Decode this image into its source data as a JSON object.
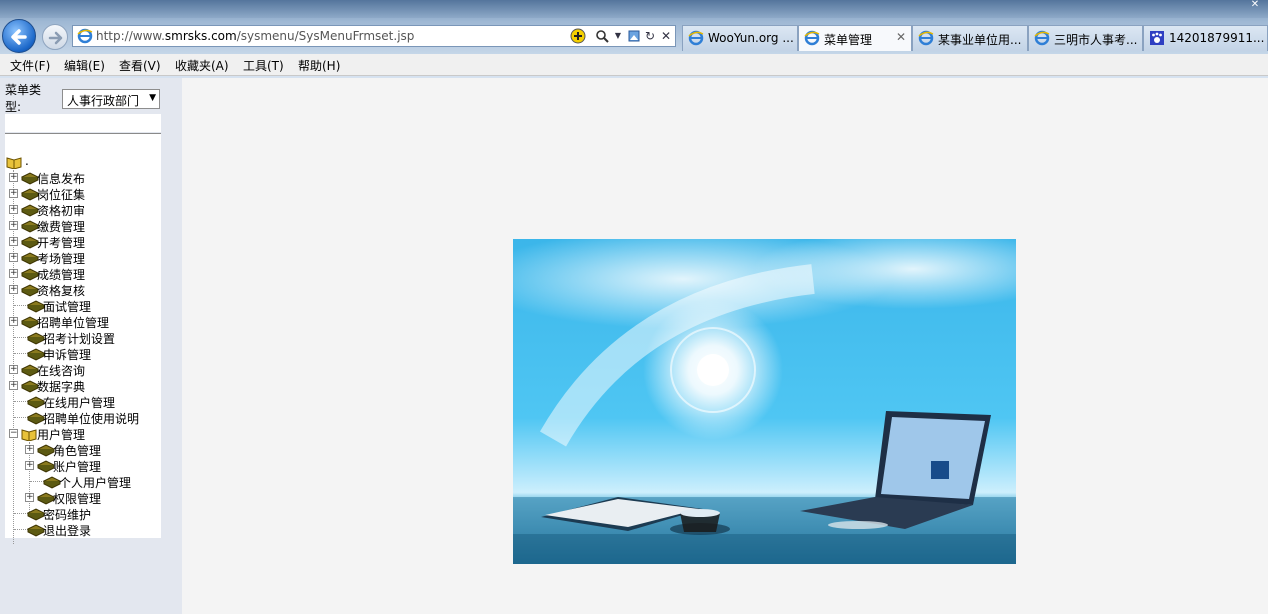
{
  "browser": {
    "url_prefix": "http://www.",
    "url_domain": "smrsks.com",
    "url_path": "/sysmenu/SysMenuFrmset.jsp",
    "tabs": [
      {
        "label": "WooYun.org ..."
      },
      {
        "label": "菜单管理",
        "close": "✕"
      },
      {
        "label": "某事业单位用..."
      },
      {
        "label": "三明市人事考..."
      },
      {
        "label": "14201879911..."
      }
    ]
  },
  "menubar": {
    "file": "文件(F)",
    "edit": "编辑(E)",
    "view": "查看(V)",
    "favorites": "收藏夹(A)",
    "tools": "工具(T)",
    "help": "帮助(H)"
  },
  "sidebar": {
    "menu_type_label": "菜单类型:",
    "menu_type_value": "人事行政部门",
    "root_label": ".",
    "items": [
      {
        "label": "信息发布"
      },
      {
        "label": "岗位征集"
      },
      {
        "label": "资格初审"
      },
      {
        "label": "缴费管理"
      },
      {
        "label": "开考管理"
      },
      {
        "label": "考场管理"
      },
      {
        "label": "成绩管理"
      },
      {
        "label": "资格复核"
      },
      {
        "label": "面试管理"
      },
      {
        "label": "招聘单位管理"
      },
      {
        "label": "招考计划设置"
      },
      {
        "label": "申诉管理"
      },
      {
        "label": "在线咨询"
      },
      {
        "label": "数据字典"
      },
      {
        "label": "在线用户管理"
      },
      {
        "label": "招聘单位使用说明"
      },
      {
        "label": "用户管理"
      },
      {
        "label": "角色管理"
      },
      {
        "label": "账户管理"
      },
      {
        "label": "个人用户管理"
      },
      {
        "label": "权限管理"
      },
      {
        "label": "密码维护"
      },
      {
        "label": "退出登录"
      }
    ]
  },
  "icons": {
    "back": "back-arrow-icon",
    "forward": "forward-arrow-icon",
    "folder": "book-icon",
    "open_folder": "open-book-icon"
  }
}
